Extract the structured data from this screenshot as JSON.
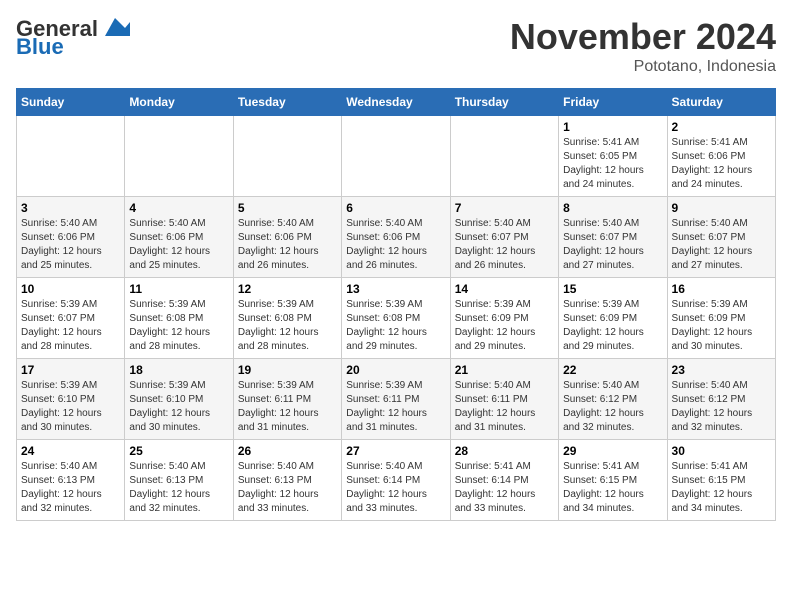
{
  "header": {
    "logo_general": "General",
    "logo_blue": "Blue",
    "month_title": "November 2024",
    "location": "Pototano, Indonesia"
  },
  "calendar": {
    "days_of_week": [
      "Sunday",
      "Monday",
      "Tuesday",
      "Wednesday",
      "Thursday",
      "Friday",
      "Saturday"
    ],
    "weeks": [
      [
        {
          "day": "",
          "info": ""
        },
        {
          "day": "",
          "info": ""
        },
        {
          "day": "",
          "info": ""
        },
        {
          "day": "",
          "info": ""
        },
        {
          "day": "",
          "info": ""
        },
        {
          "day": "1",
          "info": "Sunrise: 5:41 AM\nSunset: 6:05 PM\nDaylight: 12 hours and 24 minutes."
        },
        {
          "day": "2",
          "info": "Sunrise: 5:41 AM\nSunset: 6:06 PM\nDaylight: 12 hours and 24 minutes."
        }
      ],
      [
        {
          "day": "3",
          "info": "Sunrise: 5:40 AM\nSunset: 6:06 PM\nDaylight: 12 hours and 25 minutes."
        },
        {
          "day": "4",
          "info": "Sunrise: 5:40 AM\nSunset: 6:06 PM\nDaylight: 12 hours and 25 minutes."
        },
        {
          "day": "5",
          "info": "Sunrise: 5:40 AM\nSunset: 6:06 PM\nDaylight: 12 hours and 26 minutes."
        },
        {
          "day": "6",
          "info": "Sunrise: 5:40 AM\nSunset: 6:06 PM\nDaylight: 12 hours and 26 minutes."
        },
        {
          "day": "7",
          "info": "Sunrise: 5:40 AM\nSunset: 6:07 PM\nDaylight: 12 hours and 26 minutes."
        },
        {
          "day": "8",
          "info": "Sunrise: 5:40 AM\nSunset: 6:07 PM\nDaylight: 12 hours and 27 minutes."
        },
        {
          "day": "9",
          "info": "Sunrise: 5:40 AM\nSunset: 6:07 PM\nDaylight: 12 hours and 27 minutes."
        }
      ],
      [
        {
          "day": "10",
          "info": "Sunrise: 5:39 AM\nSunset: 6:07 PM\nDaylight: 12 hours and 28 minutes."
        },
        {
          "day": "11",
          "info": "Sunrise: 5:39 AM\nSunset: 6:08 PM\nDaylight: 12 hours and 28 minutes."
        },
        {
          "day": "12",
          "info": "Sunrise: 5:39 AM\nSunset: 6:08 PM\nDaylight: 12 hours and 28 minutes."
        },
        {
          "day": "13",
          "info": "Sunrise: 5:39 AM\nSunset: 6:08 PM\nDaylight: 12 hours and 29 minutes."
        },
        {
          "day": "14",
          "info": "Sunrise: 5:39 AM\nSunset: 6:09 PM\nDaylight: 12 hours and 29 minutes."
        },
        {
          "day": "15",
          "info": "Sunrise: 5:39 AM\nSunset: 6:09 PM\nDaylight: 12 hours and 29 minutes."
        },
        {
          "day": "16",
          "info": "Sunrise: 5:39 AM\nSunset: 6:09 PM\nDaylight: 12 hours and 30 minutes."
        }
      ],
      [
        {
          "day": "17",
          "info": "Sunrise: 5:39 AM\nSunset: 6:10 PM\nDaylight: 12 hours and 30 minutes."
        },
        {
          "day": "18",
          "info": "Sunrise: 5:39 AM\nSunset: 6:10 PM\nDaylight: 12 hours and 30 minutes."
        },
        {
          "day": "19",
          "info": "Sunrise: 5:39 AM\nSunset: 6:11 PM\nDaylight: 12 hours and 31 minutes."
        },
        {
          "day": "20",
          "info": "Sunrise: 5:39 AM\nSunset: 6:11 PM\nDaylight: 12 hours and 31 minutes."
        },
        {
          "day": "21",
          "info": "Sunrise: 5:40 AM\nSunset: 6:11 PM\nDaylight: 12 hours and 31 minutes."
        },
        {
          "day": "22",
          "info": "Sunrise: 5:40 AM\nSunset: 6:12 PM\nDaylight: 12 hours and 32 minutes."
        },
        {
          "day": "23",
          "info": "Sunrise: 5:40 AM\nSunset: 6:12 PM\nDaylight: 12 hours and 32 minutes."
        }
      ],
      [
        {
          "day": "24",
          "info": "Sunrise: 5:40 AM\nSunset: 6:13 PM\nDaylight: 12 hours and 32 minutes."
        },
        {
          "day": "25",
          "info": "Sunrise: 5:40 AM\nSunset: 6:13 PM\nDaylight: 12 hours and 32 minutes."
        },
        {
          "day": "26",
          "info": "Sunrise: 5:40 AM\nSunset: 6:13 PM\nDaylight: 12 hours and 33 minutes."
        },
        {
          "day": "27",
          "info": "Sunrise: 5:40 AM\nSunset: 6:14 PM\nDaylight: 12 hours and 33 minutes."
        },
        {
          "day": "28",
          "info": "Sunrise: 5:41 AM\nSunset: 6:14 PM\nDaylight: 12 hours and 33 minutes."
        },
        {
          "day": "29",
          "info": "Sunrise: 5:41 AM\nSunset: 6:15 PM\nDaylight: 12 hours and 34 minutes."
        },
        {
          "day": "30",
          "info": "Sunrise: 5:41 AM\nSunset: 6:15 PM\nDaylight: 12 hours and 34 minutes."
        }
      ]
    ]
  }
}
